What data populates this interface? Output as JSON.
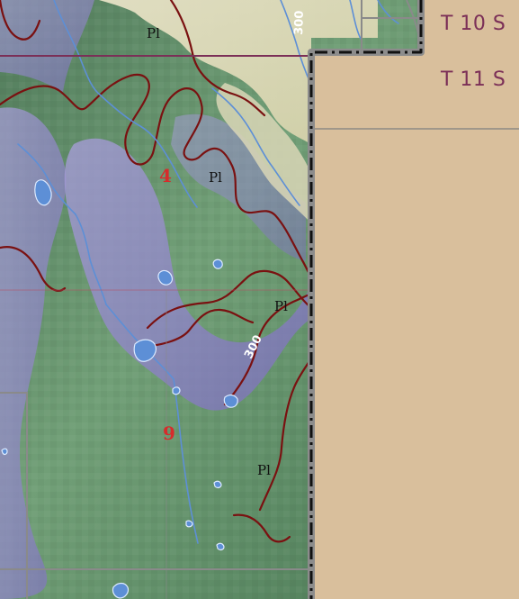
{
  "map": {
    "township_labels": {
      "north": "T 10 S",
      "south": "T 11 S"
    },
    "section_labels": {
      "upper": "4",
      "lower": "9"
    },
    "contour_labels": {
      "top": "300",
      "middle": "300"
    },
    "geology_labels": {
      "top": "Pl",
      "middle_upper": "Pl",
      "middle_right": "Pl",
      "lower_right": "Pl"
    },
    "colors": {
      "land_tan": "#d9bf9c",
      "forest_green": "#5f8f65",
      "valley_purple": "#8f84c7",
      "floodplain": "#d9d6b6",
      "contour_red": "#7a1111",
      "water_blue": "#5d8fd6",
      "boundary_black": "#111111",
      "boundary_gray": "#8c8c8c"
    }
  }
}
